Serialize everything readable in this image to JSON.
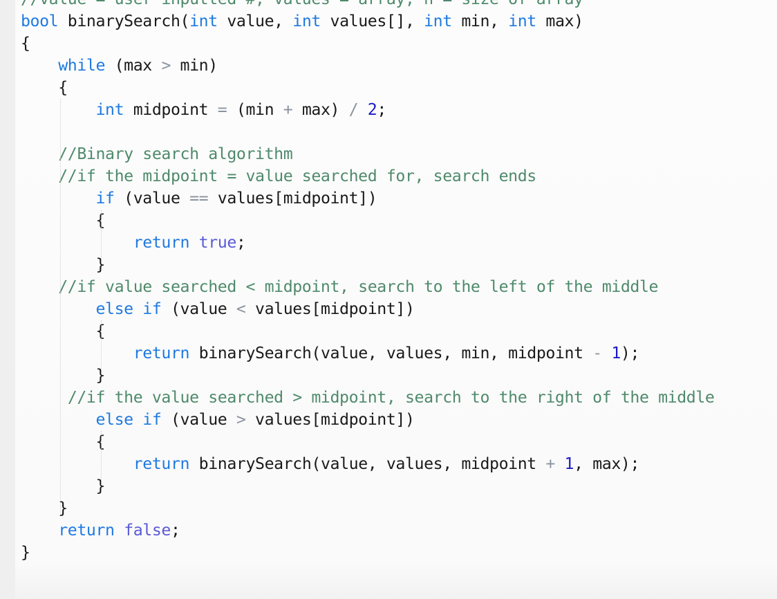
{
  "editor": {
    "language": "C",
    "lines": [
      [
        {
          "t": "cm",
          "v": "//value = user inputted #, values = array, n = size of array"
        }
      ],
      [
        {
          "t": "kw",
          "v": "bool"
        },
        {
          "t": "tx",
          "v": " binarySearch("
        },
        {
          "t": "kw",
          "v": "int"
        },
        {
          "t": "tx",
          "v": " value, "
        },
        {
          "t": "kw",
          "v": "int"
        },
        {
          "t": "tx",
          "v": " values[], "
        },
        {
          "t": "kw",
          "v": "int"
        },
        {
          "t": "tx",
          "v": " min, "
        },
        {
          "t": "kw",
          "v": "int"
        },
        {
          "t": "tx",
          "v": " max)"
        }
      ],
      [
        {
          "t": "tx",
          "v": "{"
        }
      ],
      [
        {
          "t": "tx",
          "v": "    "
        },
        {
          "t": "kw",
          "v": "while"
        },
        {
          "t": "tx",
          "v": " (max "
        },
        {
          "t": "op",
          "v": ">"
        },
        {
          "t": "tx",
          "v": " min)"
        }
      ],
      [
        {
          "t": "tx",
          "v": "    {"
        }
      ],
      [
        {
          "t": "tx",
          "v": "        "
        },
        {
          "t": "kw",
          "v": "int"
        },
        {
          "t": "tx",
          "v": " midpoint "
        },
        {
          "t": "op",
          "v": "="
        },
        {
          "t": "tx",
          "v": " (min "
        },
        {
          "t": "op",
          "v": "+"
        },
        {
          "t": "tx",
          "v": " max) "
        },
        {
          "t": "op",
          "v": "/"
        },
        {
          "t": "tx",
          "v": " "
        },
        {
          "t": "num",
          "v": "2"
        },
        {
          "t": "tx",
          "v": ";"
        }
      ],
      [
        {
          "t": "tx",
          "v": ""
        }
      ],
      [
        {
          "t": "tx",
          "v": "    "
        },
        {
          "t": "cm",
          "v": "//Binary search algorithm"
        }
      ],
      [
        {
          "t": "tx",
          "v": "    "
        },
        {
          "t": "cm",
          "v": "//if the midpoint = value searched for, search ends"
        }
      ],
      [
        {
          "t": "tx",
          "v": "        "
        },
        {
          "t": "kw",
          "v": "if"
        },
        {
          "t": "tx",
          "v": " (value "
        },
        {
          "t": "op",
          "v": "=="
        },
        {
          "t": "tx",
          "v": " values[midpoint])"
        }
      ],
      [
        {
          "t": "tx",
          "v": "        {"
        }
      ],
      [
        {
          "t": "tx",
          "v": "            "
        },
        {
          "t": "kw",
          "v": "return"
        },
        {
          "t": "tx",
          "v": " "
        },
        {
          "t": "kw2",
          "v": "true"
        },
        {
          "t": "tx",
          "v": ";"
        }
      ],
      [
        {
          "t": "tx",
          "v": "        }"
        }
      ],
      [
        {
          "t": "tx",
          "v": "    "
        },
        {
          "t": "cm",
          "v": "//if value searched < midpoint, search to the left of the middle"
        }
      ],
      [
        {
          "t": "tx",
          "v": "        "
        },
        {
          "t": "kw",
          "v": "else if"
        },
        {
          "t": "tx",
          "v": " (value "
        },
        {
          "t": "op",
          "v": "<"
        },
        {
          "t": "tx",
          "v": " values[midpoint])"
        }
      ],
      [
        {
          "t": "tx",
          "v": "        {"
        }
      ],
      [
        {
          "t": "tx",
          "v": "            "
        },
        {
          "t": "kw",
          "v": "return"
        },
        {
          "t": "tx",
          "v": " binarySearch(value, values, min, midpoint "
        },
        {
          "t": "op",
          "v": "-"
        },
        {
          "t": "tx",
          "v": " "
        },
        {
          "t": "num",
          "v": "1"
        },
        {
          "t": "tx",
          "v": ");"
        }
      ],
      [
        {
          "t": "tx",
          "v": "        }"
        }
      ],
      [
        {
          "t": "tx",
          "v": "     "
        },
        {
          "t": "cm",
          "v": "//if the value searched > midpoint, search to the right of the middle"
        }
      ],
      [
        {
          "t": "tx",
          "v": "        "
        },
        {
          "t": "kw",
          "v": "else if"
        },
        {
          "t": "tx",
          "v": " (value "
        },
        {
          "t": "op",
          "v": ">"
        },
        {
          "t": "tx",
          "v": " values[midpoint])"
        }
      ],
      [
        {
          "t": "tx",
          "v": "        {"
        }
      ],
      [
        {
          "t": "tx",
          "v": "            "
        },
        {
          "t": "kw",
          "v": "return"
        },
        {
          "t": "tx",
          "v": " binarySearch(value, values, midpoint "
        },
        {
          "t": "op",
          "v": "+"
        },
        {
          "t": "tx",
          "v": " "
        },
        {
          "t": "num",
          "v": "1"
        },
        {
          "t": "tx",
          "v": ", max);"
        }
      ],
      [
        {
          "t": "tx",
          "v": "        }"
        }
      ],
      [
        {
          "t": "tx",
          "v": "    }"
        }
      ],
      [
        {
          "t": "tx",
          "v": "    "
        },
        {
          "t": "kw",
          "v": "return"
        },
        {
          "t": "tx",
          "v": " "
        },
        {
          "t": "kw2",
          "v": "false"
        },
        {
          "t": "tx",
          "v": ";"
        }
      ],
      [
        {
          "t": "tx",
          "v": "}"
        }
      ]
    ]
  }
}
